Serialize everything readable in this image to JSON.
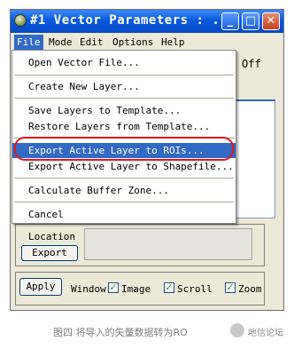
{
  "window": {
    "title": "#1 Vector Parameters : ...",
    "controls": [
      "_",
      "□",
      "✕"
    ]
  },
  "menubar": [
    "File",
    "Mode",
    "Edit",
    "Options",
    "Help"
  ],
  "file_menu": {
    "items": [
      "Open Vector File...",
      "Create New Layer...",
      "Save Layers to Template...",
      "Restore Layers from Template...",
      "Export Active Layer to ROIs...",
      "Export Active Layer to Shapefile...",
      "Calculate Buffer Zone...",
      "Cancel"
    ],
    "highlighted": "Export Active Layer to ROIs..."
  },
  "background": {
    "off_label": "Off",
    "location_label": "Location",
    "export_label": "Export",
    "apply_label": "Apply",
    "window_label": "Window",
    "checkboxes": [
      {
        "label": "Image",
        "checked": true
      },
      {
        "label": "Scroll",
        "checked": true
      },
      {
        "label": "Zoom",
        "checked": true
      }
    ]
  },
  "caption": {
    "text": "图四     将导入的矢量数据转为RO",
    "watermark": "地信论坛"
  },
  "colors": {
    "title_bar": "#0a5ae0",
    "highlight": "#316ac5",
    "annotation_ring": "#e0161c",
    "window_bg": "#ece9d8"
  }
}
